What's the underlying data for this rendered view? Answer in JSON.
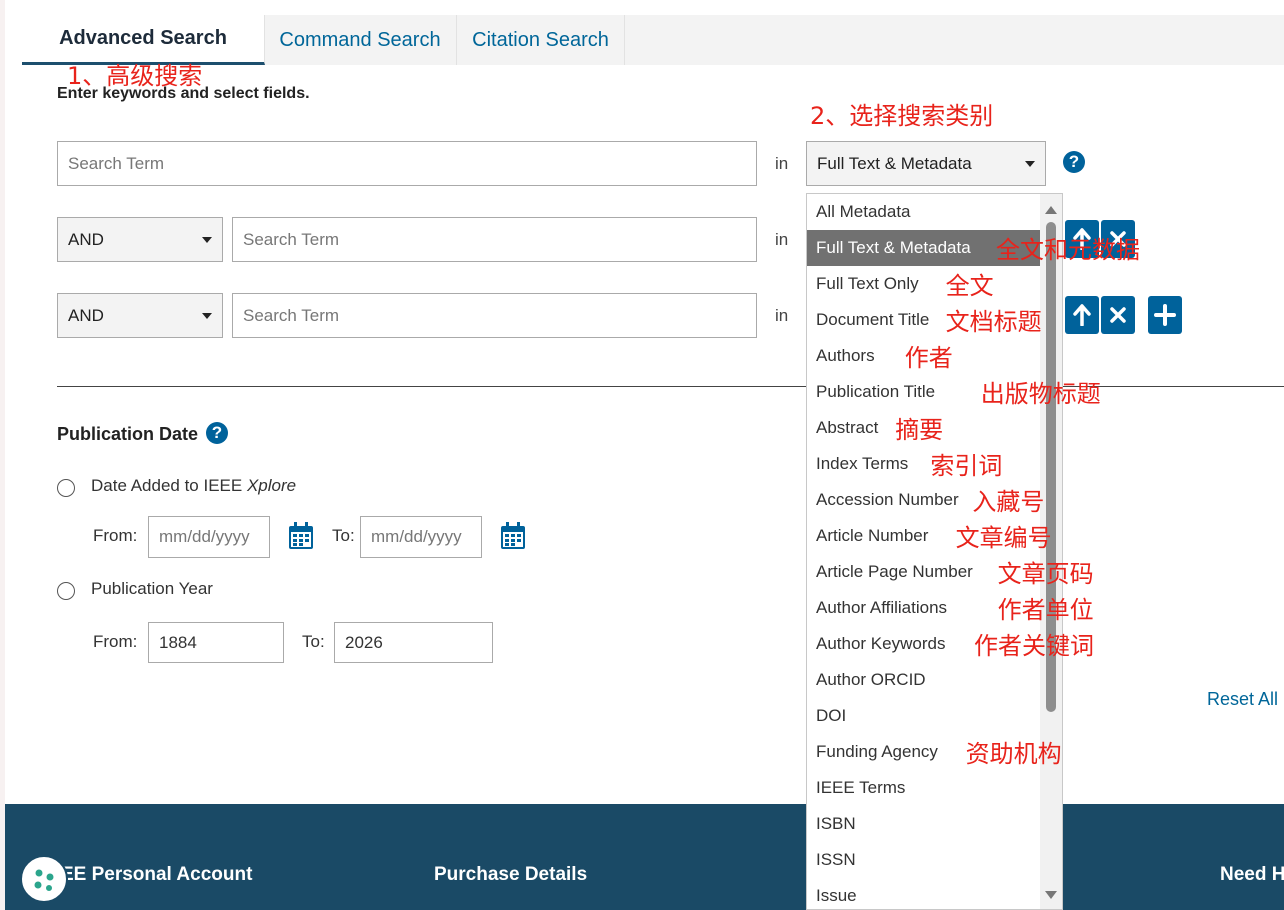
{
  "tabs": [
    {
      "label": "Advanced Search",
      "active": true
    },
    {
      "label": "Command Search",
      "active": false
    },
    {
      "label": "Citation Search",
      "active": false
    }
  ],
  "annotations": {
    "step1": "1、高级搜索",
    "step2": "2、选择搜索类别"
  },
  "instructions": "Enter keywords and select fields.",
  "search_rows": [
    {
      "operator": null,
      "placeholder": "Search Term",
      "in_label": "in",
      "field": "Full Text & Metadata"
    },
    {
      "operator": "AND",
      "placeholder": "Search Term",
      "in_label": "in"
    },
    {
      "operator": "AND",
      "placeholder": "Search Term",
      "in_label": "in"
    }
  ],
  "help_glyph": "?",
  "publication_date": {
    "title": "Publication Date",
    "option1_prefix": "Date Added to IEEE ",
    "option1_emph": "Xplore",
    "option2": "Publication Year",
    "from_label": "From:",
    "to_label": "To:",
    "date_placeholder": "mm/dd/yyyy",
    "year_from": "1884",
    "year_to": "2026"
  },
  "reset_all": "Reset All",
  "footer": {
    "personal_account": "IEEE Personal Account",
    "purchase_details": "Purchase Details",
    "need_help": "Need Help?"
  },
  "dropdown": {
    "selected_index": 1,
    "options": [
      {
        "label": "All Metadata",
        "note": ""
      },
      {
        "label": "Full Text & Metadata",
        "note": "全文和元数据"
      },
      {
        "label": "Full Text Only",
        "note": "全文"
      },
      {
        "label": "Document Title",
        "note": "文档标题"
      },
      {
        "label": "Authors",
        "note": "作者"
      },
      {
        "label": "Publication Title",
        "note": "出版物标题"
      },
      {
        "label": "Abstract",
        "note": "摘要"
      },
      {
        "label": "Index Terms",
        "note": "索引词"
      },
      {
        "label": "Accession Number",
        "note": "入藏号"
      },
      {
        "label": "Article Number",
        "note": "文章编号"
      },
      {
        "label": "Article Page Number",
        "note": "文章页码"
      },
      {
        "label": "Author Affiliations",
        "note": "作者单位"
      },
      {
        "label": "Author Keywords",
        "note": "作者关键词"
      },
      {
        "label": "Author ORCID",
        "note": ""
      },
      {
        "label": "DOI",
        "note": ""
      },
      {
        "label": "Funding Agency",
        "note": "资助机构"
      },
      {
        "label": "IEEE Terms",
        "note": ""
      },
      {
        "label": "ISBN",
        "note": ""
      },
      {
        "label": "ISSN",
        "note": ""
      },
      {
        "label": "Issue",
        "note": ""
      }
    ]
  },
  "colors": {
    "accent": "#00629b",
    "annotation": "#e8231b",
    "footer": "#1a4a66",
    "selected_option": "#717171"
  }
}
